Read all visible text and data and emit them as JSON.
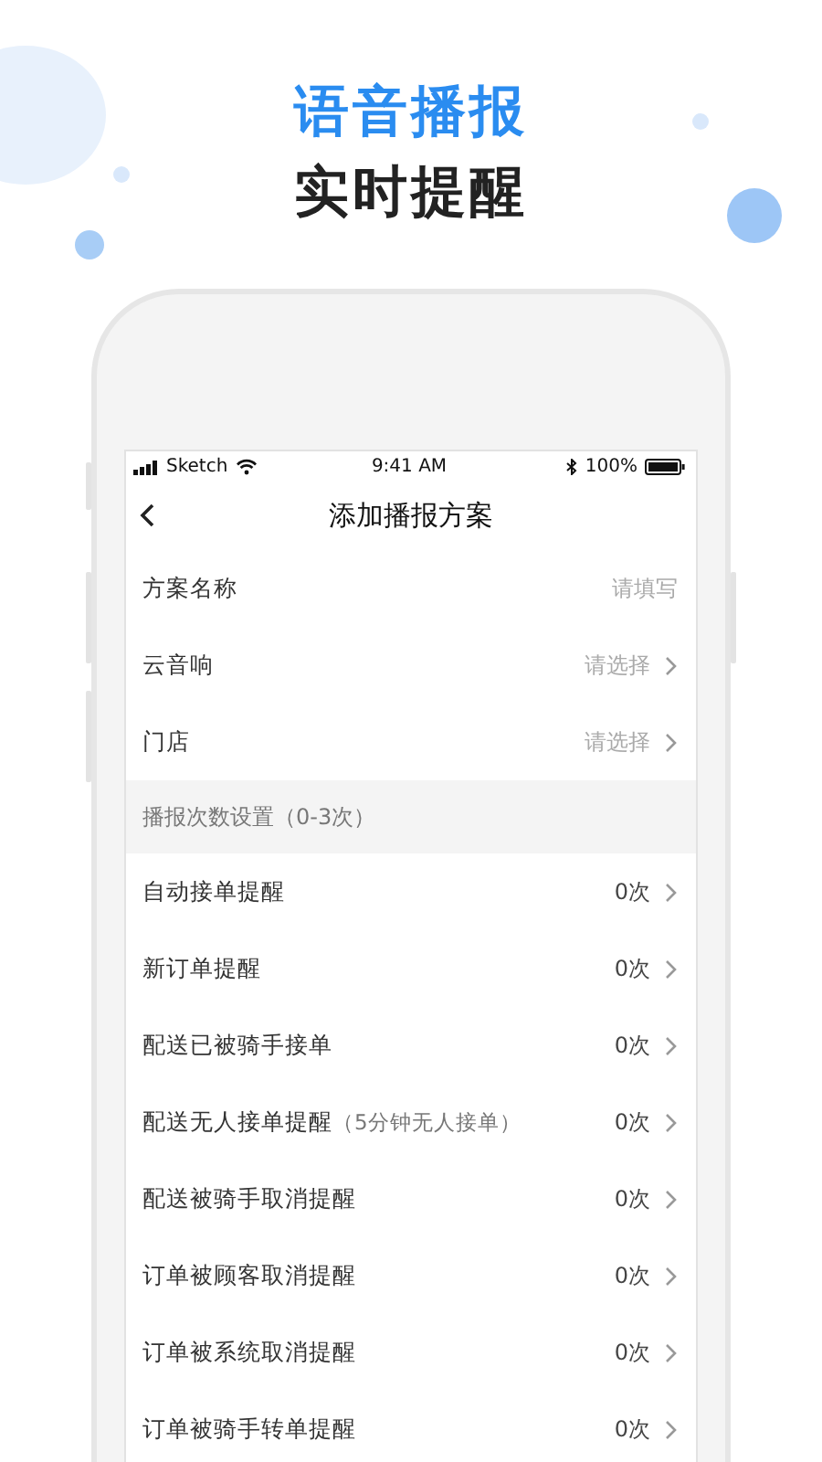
{
  "hero": {
    "title": "语音播报",
    "subtitle": "实时提醒"
  },
  "status_bar": {
    "carrier": "Sketch",
    "time": "9:41 AM",
    "battery": "100%"
  },
  "nav": {
    "title": "添加播报方案"
  },
  "fields": [
    {
      "label": "方案名称",
      "placeholder": "请填写",
      "kind": "input"
    },
    {
      "label": "云音响",
      "placeholder": "请选择",
      "kind": "select"
    },
    {
      "label": "门店",
      "placeholder": "请选择",
      "kind": "select"
    }
  ],
  "section": {
    "title": "播报次数设置（0-3次）"
  },
  "reminders": [
    {
      "label": "自动接单提醒",
      "value": "0次"
    },
    {
      "label": "新订单提醒",
      "value": "0次"
    },
    {
      "label": "配送已被骑手接单",
      "value": "0次"
    },
    {
      "label": "配送无人接单提醒",
      "note": "（5分钟无人接单）",
      "value": "0次"
    },
    {
      "label": "配送被骑手取消提醒",
      "value": "0次"
    },
    {
      "label": "订单被顾客取消提醒",
      "value": "0次"
    },
    {
      "label": "订单被系统取消提醒",
      "value": "0次"
    },
    {
      "label": "订单被骑手转单提醒",
      "value": "0次"
    }
  ]
}
